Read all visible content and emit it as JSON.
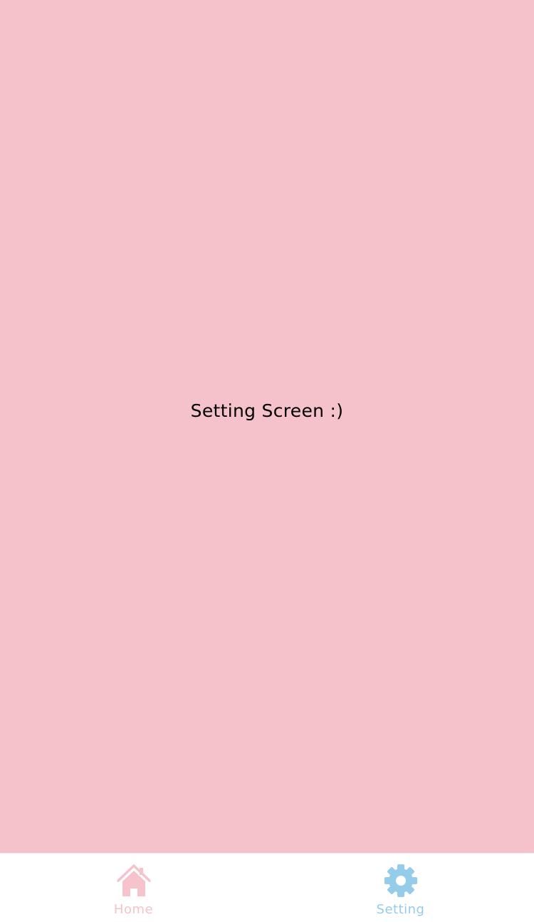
{
  "main": {
    "text": "Setting Screen :)",
    "background_color": "#F5C1CA"
  },
  "tabbar": {
    "tabs": [
      {
        "label": "Home",
        "icon": "home-icon",
        "color": "#F6C3CC",
        "active": false
      },
      {
        "label": "Setting",
        "icon": "gear-icon",
        "color": "#95CCEA",
        "active": true
      }
    ]
  }
}
